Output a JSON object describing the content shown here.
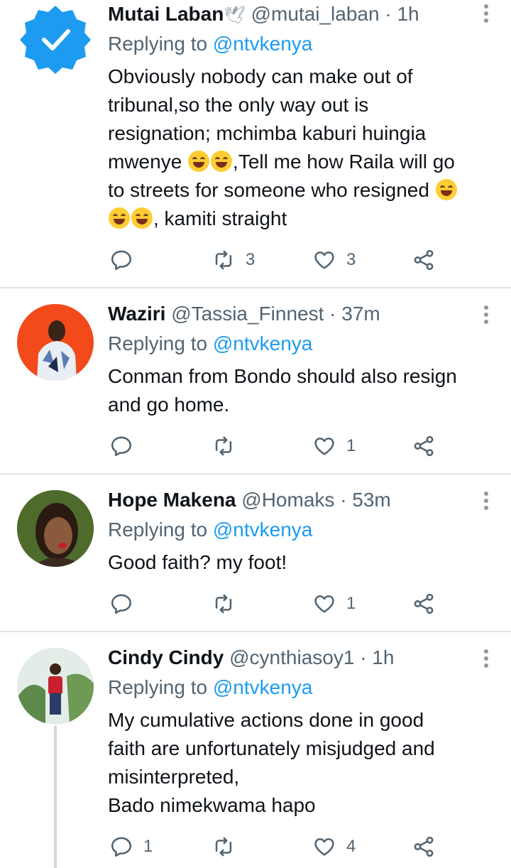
{
  "tweets": [
    {
      "name": "Mutai Laban",
      "name_emoji": "🕊",
      "handle": "@mutai_laban",
      "time": "· 1h",
      "replying_prefix": "Replying to",
      "replying_to": "@ntvkenya",
      "lines": [
        "Obviously nobody can make out of",
        "tribunal,so the only way out is",
        "resignation; mchimba kaburi huingia",
        ",Tell me how Raila will go",
        "to streets for someone who resigned",
        ", kamiti straight"
      ],
      "line4_prefix": "mwenye",
      "replies": "",
      "retweets": "3",
      "likes": "3",
      "avatar": "verified-badge"
    },
    {
      "name": "Waziri",
      "handle": "@Tassia_Finnest",
      "time": "· 37m",
      "replying_prefix": "Replying to",
      "replying_to": "@ntvkenya",
      "lines": [
        "Conman from Bondo should also resign",
        "and go home."
      ],
      "replies": "",
      "retweets": "",
      "likes": "1",
      "avatar": "orange-photo"
    },
    {
      "name": "Hope Makena",
      "handle": "@Homaks",
      "time": "· 53m",
      "replying_prefix": "Replying to",
      "replying_to": "@ntvkenya",
      "lines": [
        "Good faith? my foot!"
      ],
      "replies": "",
      "retweets": "",
      "likes": "1",
      "avatar": "portrait-photo"
    },
    {
      "name": "Cindy Cindy",
      "handle": "@cynthiasoy1",
      "time": "· 1h",
      "replying_prefix": "Replying to",
      "replying_to": "@ntvkenya",
      "lines": [
        "My cumulative actions done in good",
        "faith are unfortunately misjudged and",
        "misinterpreted,",
        "Bado nimekwama hapo"
      ],
      "replies": "1",
      "retweets": "",
      "likes": "4",
      "avatar": "outdoor-photo"
    }
  ],
  "colors": {
    "text": "#0f1419",
    "secondary": "#536471",
    "link": "#1d9bf0",
    "divider": "#e1e4e8",
    "verified_blue": "#1d9bf0"
  }
}
